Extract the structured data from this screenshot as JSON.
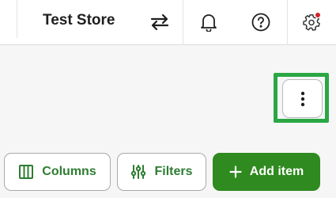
{
  "header": {
    "store_name": "Test Store",
    "icons": [
      "switch-arrows-icon",
      "bell-icon",
      "help-icon",
      "gear-icon"
    ],
    "notification_badge_color": "#d4202c"
  },
  "toolbar": {
    "columns_label": "Columns",
    "filters_label": "Filters",
    "add_item_label": "Add item",
    "more_options_icon": "vertical-ellipsis-icon"
  },
  "colors": {
    "accent": "#2f8a1f",
    "highlight": "#2aa744",
    "text_green": "#2e7d32"
  }
}
